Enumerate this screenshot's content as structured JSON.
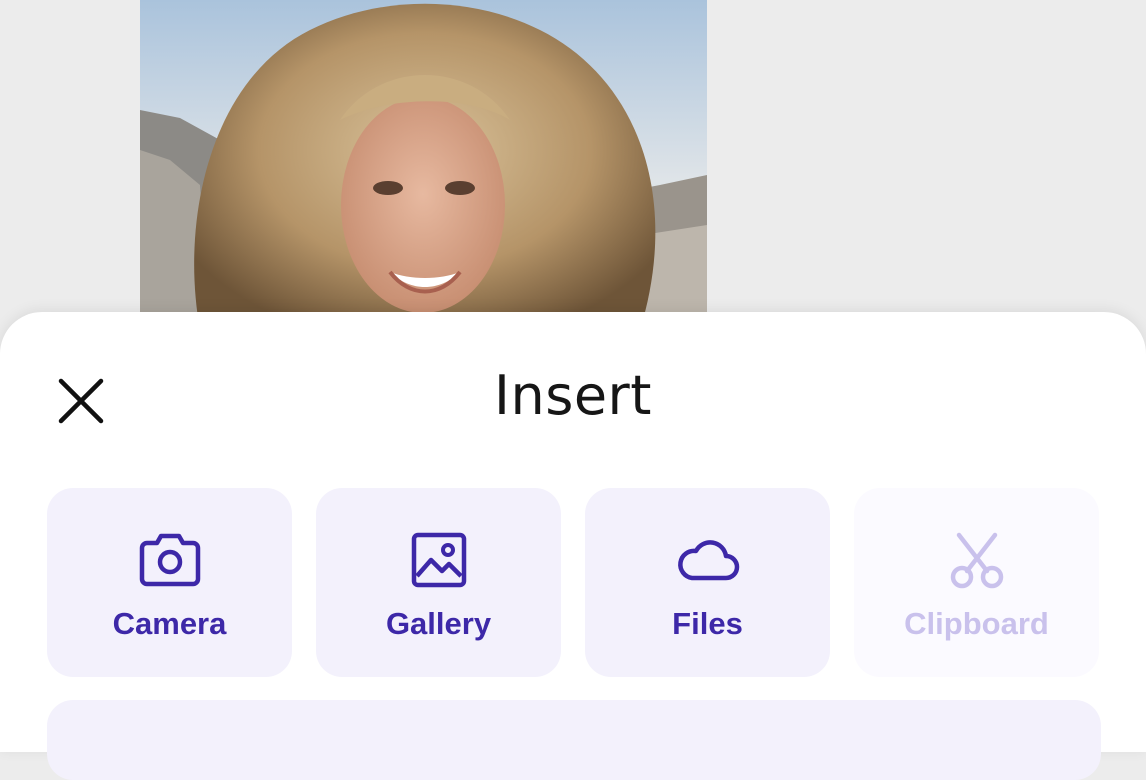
{
  "photo": {
    "alt": "Selected photo: smiling woman with curly blond hair over a city view"
  },
  "sheet": {
    "title": "Insert",
    "close_icon": "close-icon"
  },
  "options": [
    {
      "label": "Camera",
      "icon": "camera-icon",
      "enabled": true
    },
    {
      "label": "Gallery",
      "icon": "image-icon",
      "enabled": true
    },
    {
      "label": "Files",
      "icon": "cloud-icon",
      "enabled": true
    },
    {
      "label": "Clipboard",
      "icon": "scissors-icon",
      "enabled": false
    }
  ],
  "colors": {
    "accent": "#3d28a8",
    "accent_disabled": "#c9c1ec",
    "tile_background": "#f3f1fc",
    "sheet_background": "#ffffff",
    "page_background": "#ececec"
  }
}
